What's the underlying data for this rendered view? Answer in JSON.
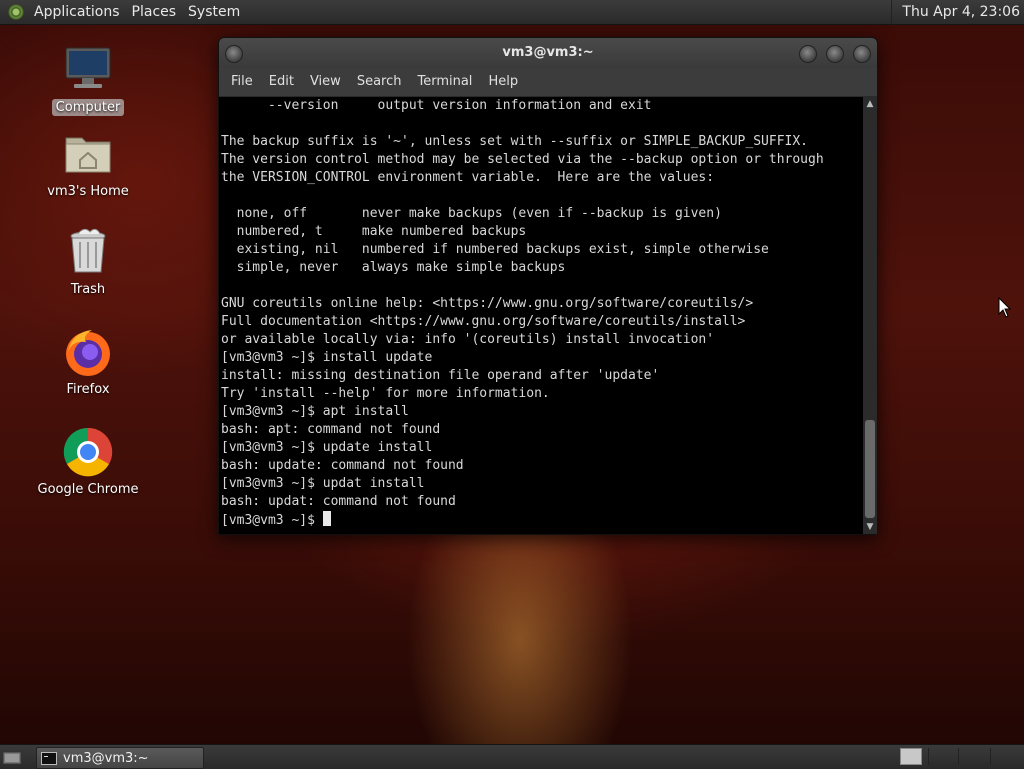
{
  "top_panel": {
    "menus": [
      "Applications",
      "Places",
      "System"
    ],
    "clock": "Thu Apr  4, 23:06"
  },
  "desktop": {
    "icons": [
      {
        "label": "Computer",
        "icon": "computer-icon",
        "selected": true
      },
      {
        "label": "vm3's Home",
        "icon": "home-folder-icon",
        "selected": false
      },
      {
        "label": "Trash",
        "icon": "trash-icon",
        "selected": false
      },
      {
        "label": "Firefox",
        "icon": "firefox-icon",
        "selected": false
      },
      {
        "label": "Google Chrome",
        "icon": "chrome-icon",
        "selected": false
      }
    ]
  },
  "terminal": {
    "title": "vm3@vm3:~",
    "menus": [
      "File",
      "Edit",
      "View",
      "Search",
      "Terminal",
      "Help"
    ],
    "lines": [
      "      --version     output version information and exit",
      "",
      "The backup suffix is '~', unless set with --suffix or SIMPLE_BACKUP_SUFFIX.",
      "The version control method may be selected via the --backup option or through",
      "the VERSION_CONTROL environment variable.  Here are the values:",
      "",
      "  none, off       never make backups (even if --backup is given)",
      "  numbered, t     make numbered backups",
      "  existing, nil   numbered if numbered backups exist, simple otherwise",
      "  simple, never   always make simple backups",
      "",
      "GNU coreutils online help: <https://www.gnu.org/software/coreutils/>",
      "Full documentation <https://www.gnu.org/software/coreutils/install>",
      "or available locally via: info '(coreutils) install invocation'",
      "[vm3@vm3 ~]$ install update",
      "install: missing destination file operand after 'update'",
      "Try 'install --help' for more information.",
      "[vm3@vm3 ~]$ apt install",
      "bash: apt: command not found",
      "[vm3@vm3 ~]$ update install",
      "bash: update: command not found",
      "[vm3@vm3 ~]$ updat install",
      "bash: updat: command not found"
    ],
    "prompt": "[vm3@vm3 ~]$ "
  },
  "taskbar": {
    "window_label": "vm3@vm3:~"
  },
  "colors": {
    "panel": "#2f2f2f",
    "terminal_bg": "#000000",
    "terminal_fg": "#d8d8d8"
  }
}
